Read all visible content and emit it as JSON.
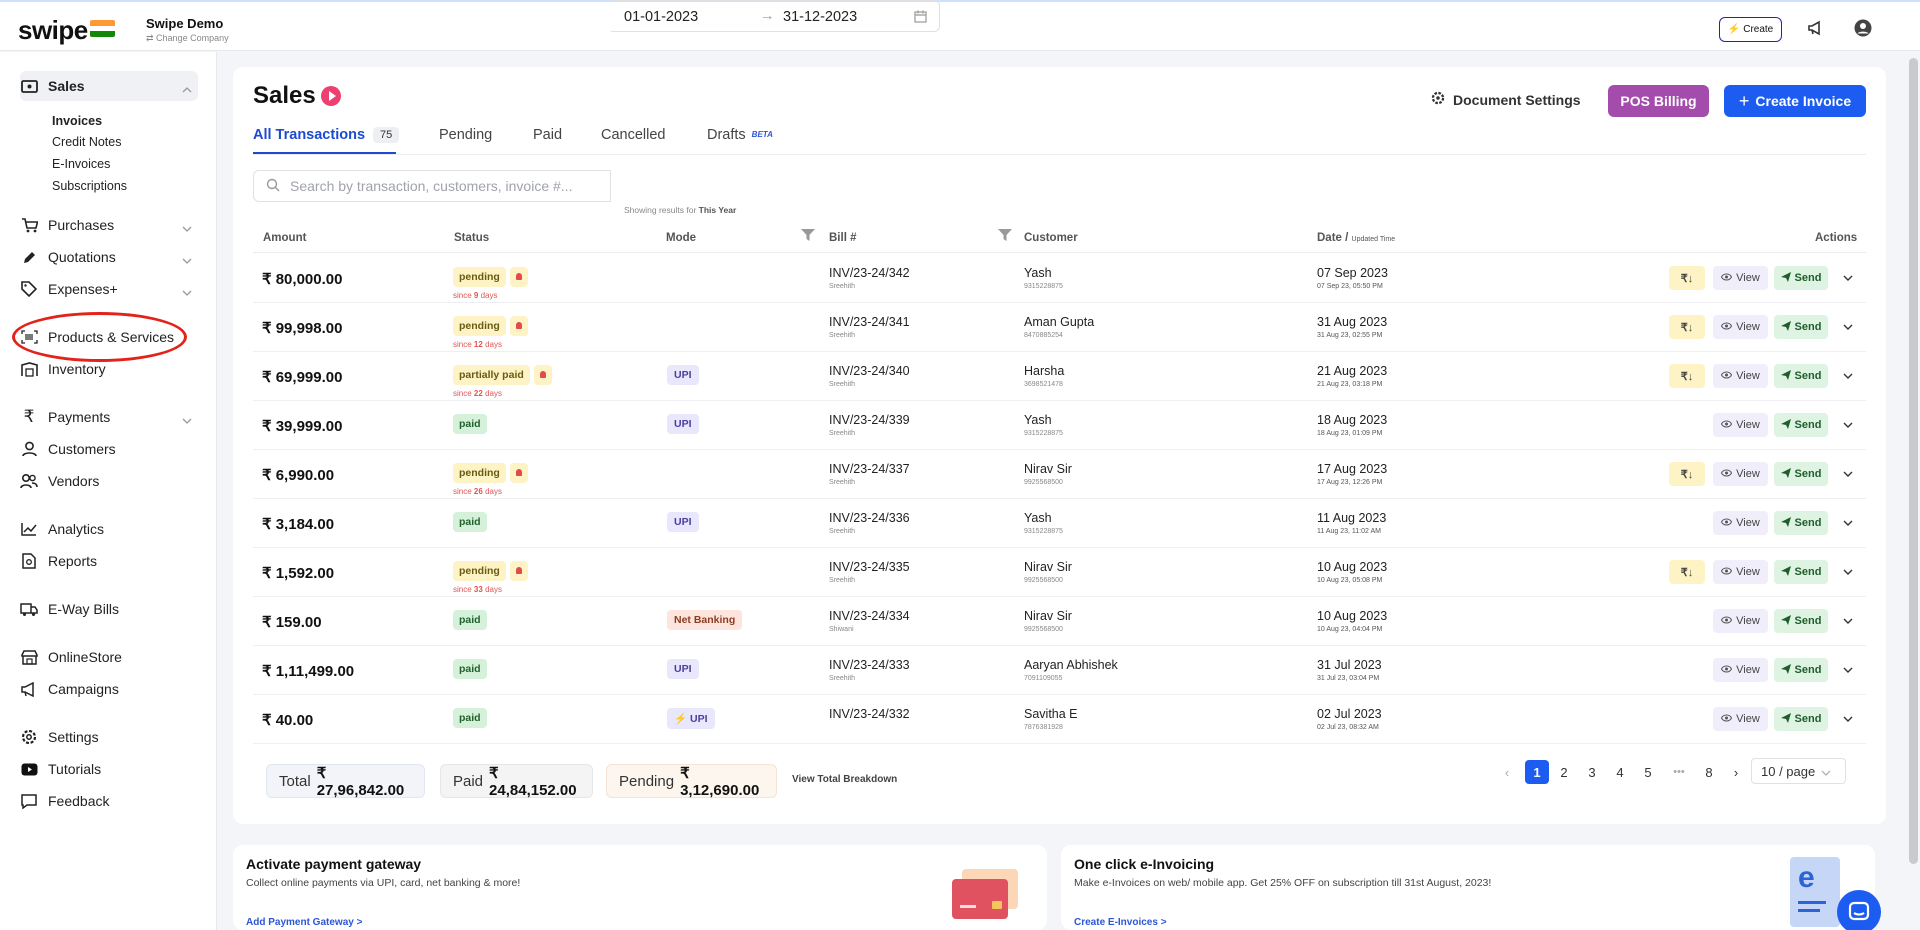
{
  "app": {
    "logo": "swipe",
    "company_name": "Swipe Demo",
    "change_company": "⇄ Change Company",
    "top_create": "Create",
    "colors": {
      "brand_blue": "#1c5cf0",
      "pos_purple": "#a34cab",
      "highlight_red": "#e2231a"
    }
  },
  "sidebar": {
    "sales": "Sales",
    "sales_sub": [
      "Invoices",
      "Credit Notes",
      "E-Invoices",
      "Subscriptions"
    ],
    "items": [
      {
        "label": "Purchases",
        "icon": "cart-icon"
      },
      {
        "label": "Quotations",
        "icon": "pen-icon"
      },
      {
        "label": "Expenses+",
        "icon": "tag-icon"
      },
      {
        "label": "Products & Services",
        "icon": "barcode-icon"
      },
      {
        "label": "Inventory",
        "icon": "warehouse-icon"
      },
      {
        "label": "Payments",
        "icon": "rupee-icon"
      },
      {
        "label": "Customers",
        "icon": "user-icon"
      },
      {
        "label": "Vendors",
        "icon": "users-icon"
      },
      {
        "label": "Analytics",
        "icon": "chart-icon"
      },
      {
        "label": "Reports",
        "icon": "report-icon"
      },
      {
        "label": "E-Way Bills",
        "icon": "truck-icon"
      },
      {
        "label": "OnlineStore",
        "icon": "store-icon"
      },
      {
        "label": "Campaigns",
        "icon": "megaphone-icon"
      },
      {
        "label": "Settings",
        "icon": "gear-icon"
      },
      {
        "label": "Tutorials",
        "icon": "youtube-icon"
      },
      {
        "label": "Feedback",
        "icon": "comment-icon"
      }
    ]
  },
  "main": {
    "title": "Sales",
    "document_settings": "Document Settings",
    "pos_billing": "POS Billing",
    "create_invoice": "Create Invoice",
    "tabs": [
      {
        "label": "All Transactions",
        "count": "75"
      },
      {
        "label": "Pending"
      },
      {
        "label": "Paid"
      },
      {
        "label": "Cancelled"
      },
      {
        "label": "Drafts",
        "badge": "BETA"
      }
    ],
    "search_placeholder": "Search by transaction, customers, invoice #...",
    "date_from": "01-01-2023",
    "date_to": "31-12-2023",
    "showing_prefix": "Showing results for",
    "showing_value": "This Year",
    "columns": {
      "amount": "Amount",
      "status": "Status",
      "mode": "Mode",
      "bill": "Bill #",
      "customer": "Customer",
      "date": "Date /",
      "date_small": "Updated Time",
      "actions": "Actions"
    },
    "actions": {
      "rupee": "₹↓",
      "view": "View",
      "send": "Send"
    },
    "rows": [
      {
        "amount": "₹ 80,000.00",
        "status": "pending",
        "since": "9",
        "mode": "",
        "bill": "INV/23-24/342",
        "bill_sub": "Sreehith",
        "customer": "Yash",
        "phone": "9315228875",
        "date": "07 Sep 2023",
        "updated": "07 Sep 23, 05:50 PM"
      },
      {
        "amount": "₹ 99,998.00",
        "status": "pending",
        "since": "12",
        "mode": "",
        "bill": "INV/23-24/341",
        "bill_sub": "Sreehith",
        "customer": "Aman Gupta",
        "phone": "8470885254",
        "date": "31 Aug 2023",
        "updated": "31 Aug 23, 02:55 PM"
      },
      {
        "amount": "₹ 69,999.00",
        "status": "partially paid",
        "since": "22",
        "mode": "UPI",
        "bill": "INV/23-24/340",
        "bill_sub": "Sreehith",
        "customer": "Harsha",
        "phone": "3698521478",
        "date": "21 Aug 2023",
        "updated": "21 Aug 23, 03:18 PM"
      },
      {
        "amount": "₹ 39,999.00",
        "status": "paid",
        "since": "",
        "mode": "UPI",
        "bill": "INV/23-24/339",
        "bill_sub": "Sreehith",
        "customer": "Yash",
        "phone": "9315228875",
        "date": "18 Aug 2023",
        "updated": "18 Aug 23, 01:09 PM"
      },
      {
        "amount": "₹ 6,990.00",
        "status": "pending",
        "since": "26",
        "mode": "",
        "bill": "INV/23-24/337",
        "bill_sub": "Sreehith",
        "customer": "Nirav Sir",
        "phone": "9925568500",
        "date": "17 Aug 2023",
        "updated": "17 Aug 23, 12:26 PM"
      },
      {
        "amount": "₹ 3,184.00",
        "status": "paid",
        "since": "",
        "mode": "UPI",
        "bill": "INV/23-24/336",
        "bill_sub": "Sreehith",
        "customer": "Yash",
        "phone": "9315228875",
        "date": "11 Aug 2023",
        "updated": "11 Aug 23, 11:02 AM"
      },
      {
        "amount": "₹ 1,592.00",
        "status": "pending",
        "since": "33",
        "mode": "",
        "bill": "INV/23-24/335",
        "bill_sub": "Sreehith",
        "customer": "Nirav Sir",
        "phone": "9925568500",
        "date": "10 Aug 2023",
        "updated": "10 Aug 23, 05:08 PM"
      },
      {
        "amount": "₹ 159.00",
        "status": "paid",
        "since": "",
        "mode": "Net Banking",
        "bill": "INV/23-24/334",
        "bill_sub": "Shiwani",
        "customer": "Nirav Sir",
        "phone": "9925568500",
        "date": "10 Aug 2023",
        "updated": "10 Aug 23, 04:04 PM"
      },
      {
        "amount": "₹ 1,11,499.00",
        "status": "paid",
        "since": "",
        "mode": "UPI",
        "bill": "INV/23-24/333",
        "bill_sub": "Sreehith",
        "customer": "Aaryan Abhishek",
        "phone": "7091109055",
        "date": "31 Jul 2023",
        "updated": "31 Jul 23, 03:04 PM"
      },
      {
        "amount": "₹ 40.00",
        "status": "paid",
        "since": "",
        "mode": "⚡ UPI",
        "bill": "INV/23-24/332",
        "bill_sub": "",
        "customer": "Savitha E",
        "phone": "7876381928",
        "date": "02 Jul 2023",
        "updated": "02 Jul 23, 08:32 AM"
      }
    ],
    "since_prefix": "since",
    "since_suffix": "days",
    "totals": {
      "total_label": "Total",
      "total_value": "₹ 27,96,842.00",
      "paid_label": "Paid",
      "paid_value": "₹ 24,84,152.00",
      "pending_label": "Pending",
      "pending_value": "₹ 3,12,690.00",
      "breakdown": "View Total Breakdown"
    },
    "pagination": {
      "pages": [
        "1",
        "2",
        "3",
        "4",
        "5",
        "•••",
        "8"
      ],
      "current": "1",
      "page_size": "10 / page"
    }
  },
  "promos": [
    {
      "title": "Activate payment gateway",
      "desc": "Collect online payments via UPI, card, net banking & more!",
      "link": "Add Payment Gateway >"
    },
    {
      "title": "One click e-Invoicing",
      "desc": "Make e-Invoices on web/ mobile app. Get 25% OFF on subscription till 31st August, 2023!",
      "link": "Create E-Invoices >"
    }
  ]
}
